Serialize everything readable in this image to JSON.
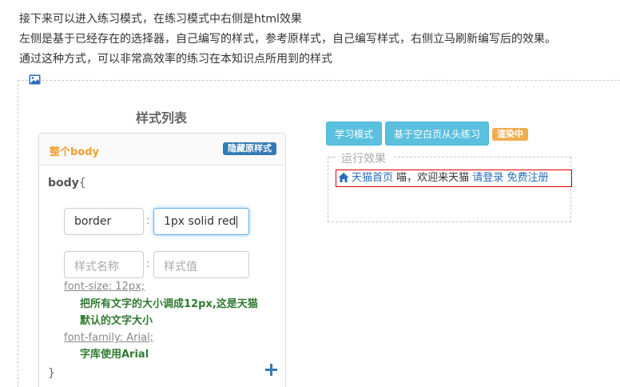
{
  "intro": {
    "line1": "接下来可以进入练习模式，在练习模式中右侧是html效果",
    "line2": "左侧是基于已经存在的选择器，自己编写的样式，参考原样式，自己编写样式，右侧立马刷新编写后的效果。",
    "line3": "通过这种方式，可以非常高效率的练习在本知识点所用到的样式"
  },
  "style_list": {
    "title": "样式列表",
    "panel_name": "整个body",
    "hide_badge": "隐藏原样式",
    "selector": "body",
    "open_brace": "{",
    "close_brace": "}",
    "colon": ":",
    "row1": {
      "name": "border",
      "value": "1px solid  red"
    },
    "row2": {
      "name_placeholder": "样式名称",
      "value_placeholder": "样式值"
    },
    "refs": [
      {
        "prop": "font-size: 12px;",
        "desc1": "把所有文字的大小调成12px,这是天猫",
        "desc2": "默认的文字大小"
      },
      {
        "prop": "font-family: Arial;",
        "desc1": "字库使用Arial"
      }
    ]
  },
  "toolbar": {
    "study_mode": "学习模式",
    "blank_practice": "基于空白页从头练习",
    "render_badge": "渲染中"
  },
  "run": {
    "label": "运行效果",
    "home_link": "天猫首页",
    "greeting": " 喵，欢迎来天猫 ",
    "login": "请登录",
    "register": "免费注册"
  },
  "icons": {
    "picture": "image-icon",
    "home": "home-icon",
    "add": "plus-icon"
  },
  "colors": {
    "accent_blue": "#337ab7",
    "button_info": "#5bc0de",
    "badge_orange": "#f0ad4e",
    "panel_name": "#f0a030",
    "desc_green": "#2f7a2f",
    "preview_border": "#e00000"
  }
}
